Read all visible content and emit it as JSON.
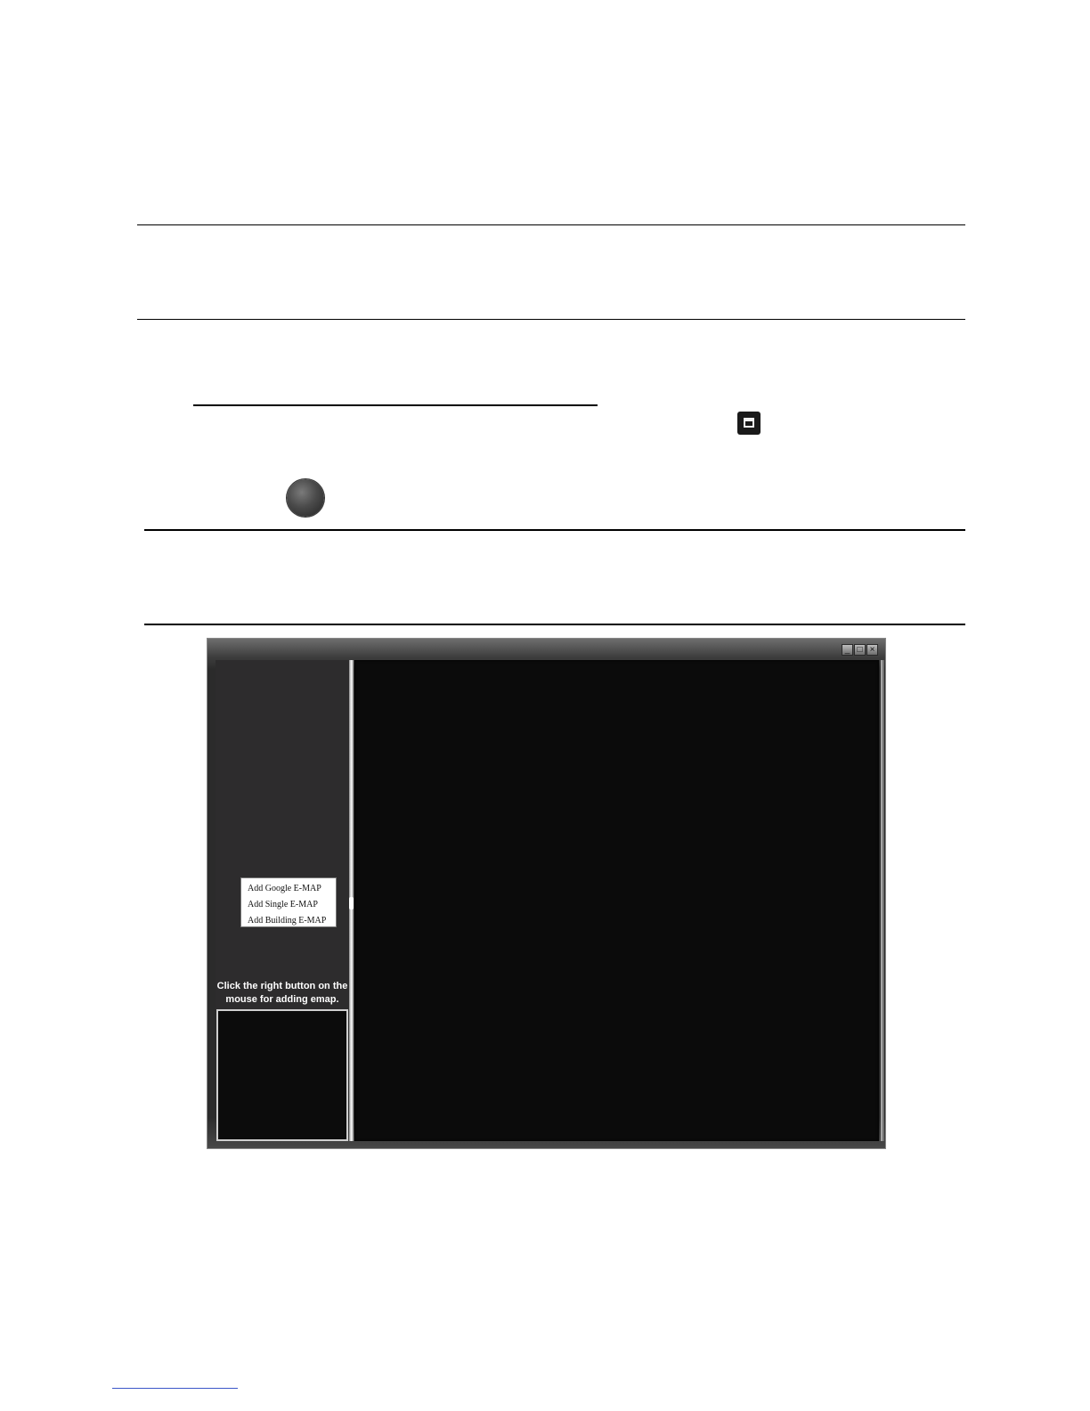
{
  "window": {
    "controls": {
      "minimize": "_",
      "maximize": "□",
      "close": "×"
    },
    "context_menu": {
      "items": [
        "Add Google E-MAP",
        "Add Single E-MAP",
        "Add Building E-MAP"
      ]
    },
    "hint_text": "Click the right button on the mouse for adding emap."
  },
  "icons": {
    "window_icon": "window-icon",
    "emap_icon": "emap-globe-icon"
  }
}
